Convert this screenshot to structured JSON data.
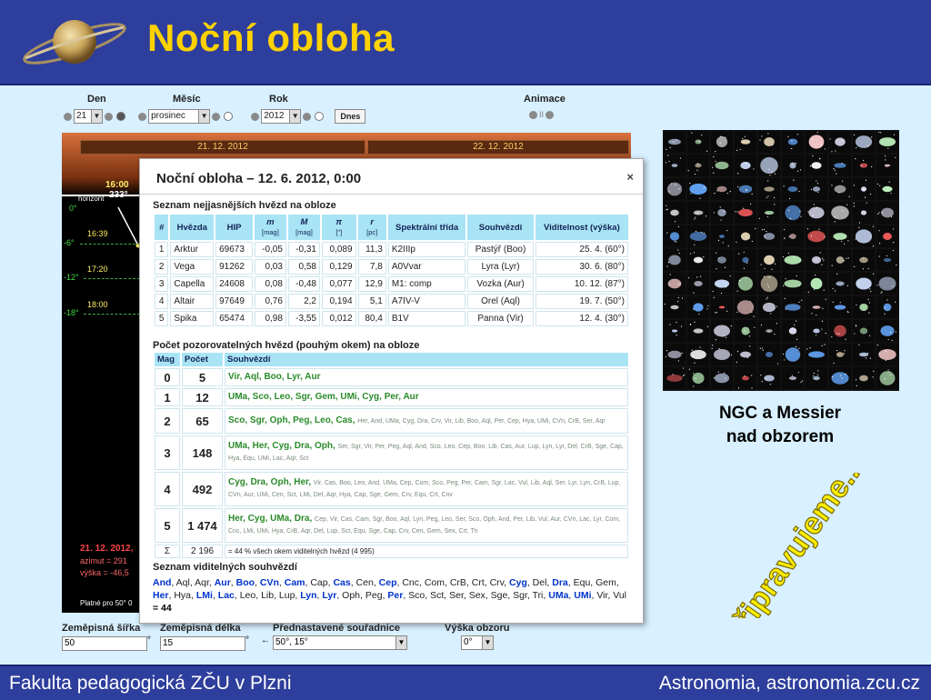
{
  "slide": {
    "title": "Noční obloha",
    "footer_left": "Fakulta pedagogická ZČU v Plzni",
    "footer_right": "Astronomia, astronomia.zcu.cz"
  },
  "controls": {
    "day_label": "Den",
    "month_label": "Měsíc",
    "year_label": "Rok",
    "animation_label": "Animace",
    "day_value": "21",
    "month_value": "prosinec",
    "year_value": "2012",
    "today_button": "Dnes",
    "pause_symbol": "II"
  },
  "sky": {
    "date_left": "21. 12. 2012",
    "date_right": "22. 12. 2012",
    "horizon_label": "horizont",
    "time_1600": "16:00",
    "azimuth_233": "233°",
    "time_1639": "16:39",
    "time_1720": "17:20",
    "time_1800": "18:00",
    "alt_0": "0°",
    "alt_6": "-6°",
    "alt_12": "-12°",
    "alt_18": "-18°",
    "info_date": "21. 12. 2012,",
    "info_azimut": "azimut = 291",
    "info_vyska": "výška = -46,5",
    "valid_for": "Platné pro 50° 0"
  },
  "panel": {
    "title": "Noční obloha – 12. 6. 2012, 0:00",
    "close_symbol": "×",
    "section_brightest": "Seznam nejjasnějších hvězd na obloze",
    "headers": {
      "num": "#",
      "star": "Hvězda",
      "hip": "HIP",
      "m": "m",
      "m_unit": "[mag]",
      "M": "M",
      "M_unit": "[mag]",
      "pi": "π",
      "pi_unit": "[\"]",
      "r": "r",
      "r_unit": "[pc]",
      "spectral": "Spektrální třída",
      "constellation": "Souhvězdí",
      "visibility": "Viditelnost (výška)"
    },
    "stars": [
      {
        "n": "1",
        "name": "Arktur",
        "hip": "69673",
        "m": "-0,05",
        "M": "-0,31",
        "pi": "0,089",
        "r": "11,3",
        "spec": "K2IIIp",
        "con": "Pastýř (Boo)",
        "vis": "25.  4. (60°)"
      },
      {
        "n": "2",
        "name": "Vega",
        "hip": "91262",
        "m": "0,03",
        "M": "0,58",
        "pi": "0,129",
        "r": "7,8",
        "spec": "A0Vvar",
        "con": "Lyra (Lyr)",
        "vis": "30.  6. (80°)"
      },
      {
        "n": "3",
        "name": "Capella",
        "hip": "24608",
        "m": "0,08",
        "M": "-0,48",
        "pi": "0,077",
        "r": "12,9",
        "spec": "M1: comp",
        "con": "Vozka (Aur)",
        "vis": "10. 12. (87°)"
      },
      {
        "n": "4",
        "name": "Altair",
        "hip": "97649",
        "m": "0,76",
        "M": "2,2",
        "pi": "0,194",
        "r": "5,1",
        "spec": "A7IV-V",
        "con": "Orel (Aql)",
        "vis": "19.  7. (50°)"
      },
      {
        "n": "5",
        "name": "Spika",
        "hip": "65474",
        "m": "0,98",
        "M": "-3,55",
        "pi": "0,012",
        "r": "80,4",
        "spec": "B1V",
        "con": "Panna (Vir)",
        "vis": "12.  4. (30°)"
      }
    ],
    "section_count": "Počet pozorovatelných hvězd (pouhým okem) na obloze",
    "count_headers": {
      "mag": "Mag",
      "count": "Počet",
      "constellations": "Souhvězdí"
    },
    "counts": [
      {
        "mag": "0",
        "count": "5",
        "main": "Vir, Aql, Boo, Lyr, Aur",
        "rest": ""
      },
      {
        "mag": "1",
        "count": "12",
        "main": "UMa, Sco, Leo, Sgr, Gem, UMi, Cyg, Per, Aur",
        "rest": ""
      },
      {
        "mag": "2",
        "count": "65",
        "main": "Sco, Sgr, Oph, Peg, Leo, Cas,",
        "rest": "Her, And, UMa, Cyg, Dra, Crv, Vir, Lib, Boo, Aql, Per, Cep, Hya, UMi, CVn, CrB, Ser, Aqr"
      },
      {
        "mag": "3",
        "count": "148",
        "main": "UMa, Her, Cyg, Dra, Oph,",
        "rest": "Ser, Sgr, Vir, Per, Peg, Aql, And, Sco, Leo, Cep, Boo, Lib, Cas, Aur, Lup, Lyn, Lyr, Del, CrB, Sge, Cap, Hya, Equ, UMi, Lac, Aqr, Sct"
      },
      {
        "mag": "4",
        "count": "492",
        "main": "Cyg, Dra, Oph, Her,",
        "rest": "Vir, Cas, Boo, Leo, And, UMa, Cep, Com, Sco, Peg, Per, Cam, Sgr, Lac, Vul, Lib, Aql, Ser, Lyr, Lyn, CrB, Lup, CVn, Aur, UMi, Cen, Sct, LMi, Del, Aqr, Hya, Cap, Sge, Gem, Crv, Equ, Crt, Cnv"
      },
      {
        "mag": "5",
        "count": "1 474",
        "main": "Her, Cyg, UMa, Dra,",
        "rest": "Cep, Vir, Cas, Cam, Sgr, Boo, Aql, Lyn, Peg, Leo, Ser, Sco, Oph, And, Per, Lib, Vul, Aur, CVn, Lac, Lyr, Com, Cnc, LMi, UMi, Hya, CrB, Aqr, Del, Lup, Sct, Equ, Sge, Cap, Crv, Cen, Gem, Sex, Crt, Tri"
      }
    ],
    "sum_symbol": "Σ",
    "sum_count": "2 196",
    "sum_note": "= 44 % všech okem viditelných hvězd (4 995)",
    "section_visible": "Seznam viditelných souhvězdí",
    "visible_tokens": [
      {
        "t": "And",
        "b": true
      },
      {
        "t": ", Aql, Aqr, ",
        "b": false
      },
      {
        "t": "Aur",
        "b": true
      },
      {
        "t": ", ",
        "b": false
      },
      {
        "t": "Boo",
        "b": true
      },
      {
        "t": ", ",
        "b": false
      },
      {
        "t": "CVn",
        "b": true
      },
      {
        "t": ", ",
        "b": false
      },
      {
        "t": "Cam",
        "b": true
      },
      {
        "t": ", Cap, ",
        "b": false
      },
      {
        "t": "Cas",
        "b": true
      },
      {
        "t": ", Cen, ",
        "b": false
      },
      {
        "t": "Cep",
        "b": true
      },
      {
        "t": ", Cnc, Com, CrB, Crt, Crv, ",
        "b": false
      },
      {
        "t": "Cyg",
        "b": true
      },
      {
        "t": ", Del, ",
        "b": false
      },
      {
        "t": "Dra",
        "b": true
      },
      {
        "t": ", Equ, Gem, ",
        "b": false
      },
      {
        "t": "Her",
        "b": true
      },
      {
        "t": ", Hya, ",
        "b": false
      },
      {
        "t": "LMi",
        "b": true
      },
      {
        "t": ", ",
        "b": false
      },
      {
        "t": "Lac",
        "b": true
      },
      {
        "t": ", Leo, Lib, Lup, ",
        "b": false
      },
      {
        "t": "Lyn",
        "b": true
      },
      {
        "t": ", ",
        "b": false
      },
      {
        "t": "Lyr",
        "b": true
      },
      {
        "t": ", Oph, Peg, ",
        "b": false
      },
      {
        "t": "Per",
        "b": true
      },
      {
        "t": ", Sco, Sct, Ser, Sex, Sge, Sgr, Tri, ",
        "b": false
      },
      {
        "t": "UMa",
        "b": true
      },
      {
        "t": ", ",
        "b": false
      },
      {
        "t": "UMi",
        "b": true
      },
      {
        "t": ", Vir, Vul ",
        "b": false
      }
    ],
    "visible_total": "= 44"
  },
  "bottom": {
    "lat_label": "Zeměpisná šířka",
    "lat_value": "50",
    "lon_label": "Zeměpisná délka",
    "lon_value": "15",
    "preset_label": "Přednastavené souřadnice",
    "preset_value": "50°, 15°",
    "horizon_label": "Výška obzoru",
    "horizon_value": "0°",
    "deg": "°",
    "arrow": "←"
  },
  "gallery": {
    "caption_line1": "NGC a Messier",
    "caption_line2": "nad obzorem",
    "banner": "připravujeme.."
  },
  "colors": {
    "header_bg": "#2e3e9c",
    "title": "#ffd200",
    "slide_bg": "#d8f0ff",
    "table_header": "#a9e4f5",
    "constellation_green": "#2a8a2a",
    "constellation_blue": "#0033cc",
    "banner": "#ffee00"
  }
}
